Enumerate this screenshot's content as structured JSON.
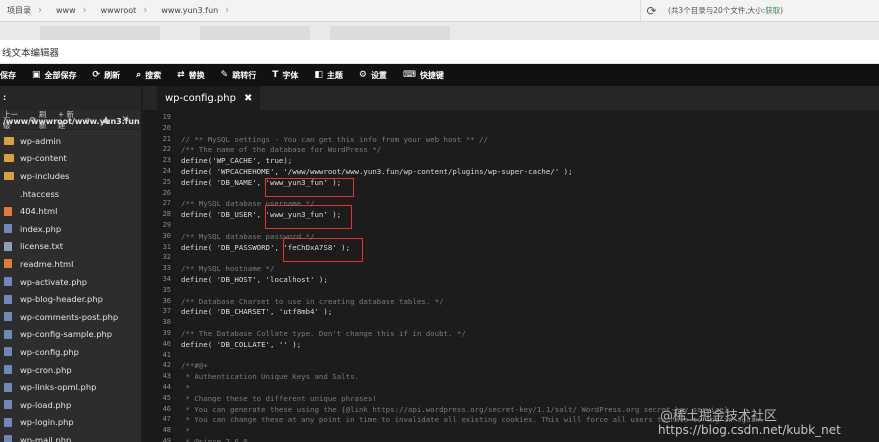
{
  "address_bar": {
    "crumbs": [
      "项目录",
      "www",
      "wwwroot",
      "www.yun3.fun"
    ],
    "refresh_icon": "refresh-icon",
    "dir_info_prefix": "(共3个目录与20个文件,大小:",
    "dir_info_link": "获取",
    "dir_info_suffix": ")"
  },
  "window": {
    "title": "线文本编辑器"
  },
  "toolbar": {
    "items": [
      {
        "icon": "save-icon",
        "label": "保存"
      },
      {
        "icon": "save-all-icon",
        "label": "全部保存"
      },
      {
        "icon": "refresh-icon",
        "label": "刷新"
      },
      {
        "icon": "search-icon",
        "label": "搜索"
      },
      {
        "icon": "replace-icon",
        "label": "替换"
      },
      {
        "icon": "goto-icon",
        "label": "跳转行"
      },
      {
        "icon": "font-icon",
        "label": "字体"
      },
      {
        "icon": "theme-icon",
        "label": "主题"
      },
      {
        "icon": "settings-icon",
        "label": "设置"
      },
      {
        "icon": "shortcut-icon",
        "label": "快捷键"
      }
    ]
  },
  "sidebar": {
    "path": ": /www/wwwroot/www.yun3.fun",
    "actions": {
      "up": "上一级",
      "refresh": "刷新",
      "new": "+ 新建"
    },
    "files": [
      {
        "name": "wp-admin",
        "type": "folder"
      },
      {
        "name": "wp-content",
        "type": "folder"
      },
      {
        "name": "wp-includes",
        "type": "folder"
      },
      {
        "name": ".htaccess",
        "type": "blank"
      },
      {
        "name": "404.html",
        "type": "html"
      },
      {
        "name": "index.php",
        "type": "php"
      },
      {
        "name": "license.txt",
        "type": "txt"
      },
      {
        "name": "readme.html",
        "type": "html"
      },
      {
        "name": "wp-activate.php",
        "type": "php"
      },
      {
        "name": "wp-blog-header.php",
        "type": "php"
      },
      {
        "name": "wp-comments-post.php",
        "type": "php"
      },
      {
        "name": "wp-config-sample.php",
        "type": "php"
      },
      {
        "name": "wp-config.php",
        "type": "php"
      },
      {
        "name": "wp-cron.php",
        "type": "php"
      },
      {
        "name": "wp-links-opml.php",
        "type": "php"
      },
      {
        "name": "wp-load.php",
        "type": "php"
      },
      {
        "name": "wp-login.php",
        "type": "php"
      },
      {
        "name": "wp-mail.php",
        "type": "php"
      }
    ]
  },
  "editor": {
    "tab_label": "wp-config.php",
    "lines": [
      {
        "n": "19",
        "t": ""
      },
      {
        "n": "20",
        "t": ""
      },
      {
        "n": "21",
        "t": "// ** MySQL settings - You can get this info from your web host ** //",
        "cls": "c"
      },
      {
        "n": "22",
        "t": "/** The name of the database for WordPress */",
        "cls": "c"
      },
      {
        "n": "23",
        "t": "define('WP_CACHE', true);"
      },
      {
        "n": "24",
        "t": "define( 'WPCACHEHOME', '/www/wwwroot/www.yun3.fun/wp-content/plugins/wp-super-cache/' );"
      },
      {
        "n": "25",
        "t": "define( 'DB_NAME', 'www_yun3_fun' );"
      },
      {
        "n": "26",
        "t": ""
      },
      {
        "n": "27",
        "t": "/** MySQL database username */",
        "cls": "c"
      },
      {
        "n": "28",
        "t": "define( 'DB_USER', 'www_yun3_fun' );"
      },
      {
        "n": "29",
        "t": ""
      },
      {
        "n": "30",
        "t": "/** MySQL database password */",
        "cls": "c"
      },
      {
        "n": "31",
        "t": "define( 'DB_PASSWORD', 'feChDxA7S8' );"
      },
      {
        "n": "32",
        "t": ""
      },
      {
        "n": "33",
        "t": "/** MySQL hostname */",
        "cls": "c"
      },
      {
        "n": "34",
        "t": "define( 'DB_HOST', 'localhost' );"
      },
      {
        "n": "35",
        "t": ""
      },
      {
        "n": "36",
        "t": "/** Database Charset to use in creating database tables. */",
        "cls": "c"
      },
      {
        "n": "37",
        "t": "define( 'DB_CHARSET', 'utf8mb4' );"
      },
      {
        "n": "38",
        "t": ""
      },
      {
        "n": "39",
        "t": "/** The Database Collate type. Don't change this if in doubt. */",
        "cls": "c"
      },
      {
        "n": "40",
        "t": "define( 'DB_COLLATE', '' );"
      },
      {
        "n": "41",
        "t": ""
      },
      {
        "n": "42",
        "t": "/**#@+",
        "cls": "c"
      },
      {
        "n": "43",
        "t": " * Authentication Unique Keys and Salts.",
        "cls": "c"
      },
      {
        "n": "44",
        "t": " *",
        "cls": "c"
      },
      {
        "n": "45",
        "t": " * Change these to different unique phrases!",
        "cls": "c"
      },
      {
        "n": "46",
        "t": " * You can generate these using the {@link https://api.wordpress.org/secret-key/1.1/salt/ WordPress.org secret-key service}",
        "cls": "c"
      },
      {
        "n": "47",
        "t": " * You can change these at any point in time to invalidate all existing cookies. This will force all users to have to log in again.",
        "cls": "c"
      },
      {
        "n": "48",
        "t": " *",
        "cls": "c"
      },
      {
        "n": "49",
        "t": " * @since 2.6.0",
        "cls": "c"
      }
    ]
  },
  "watermark": {
    "line1": "@稀土掘金技术社区",
    "line2": "https://blog.csdn.net/kubk_net"
  },
  "colors": {
    "highlight_box": "#e8312f",
    "toolbar_bg": "#111111",
    "sidebar_bg": "#2d2d2d",
    "editor_bg": "#1c1c1c"
  }
}
